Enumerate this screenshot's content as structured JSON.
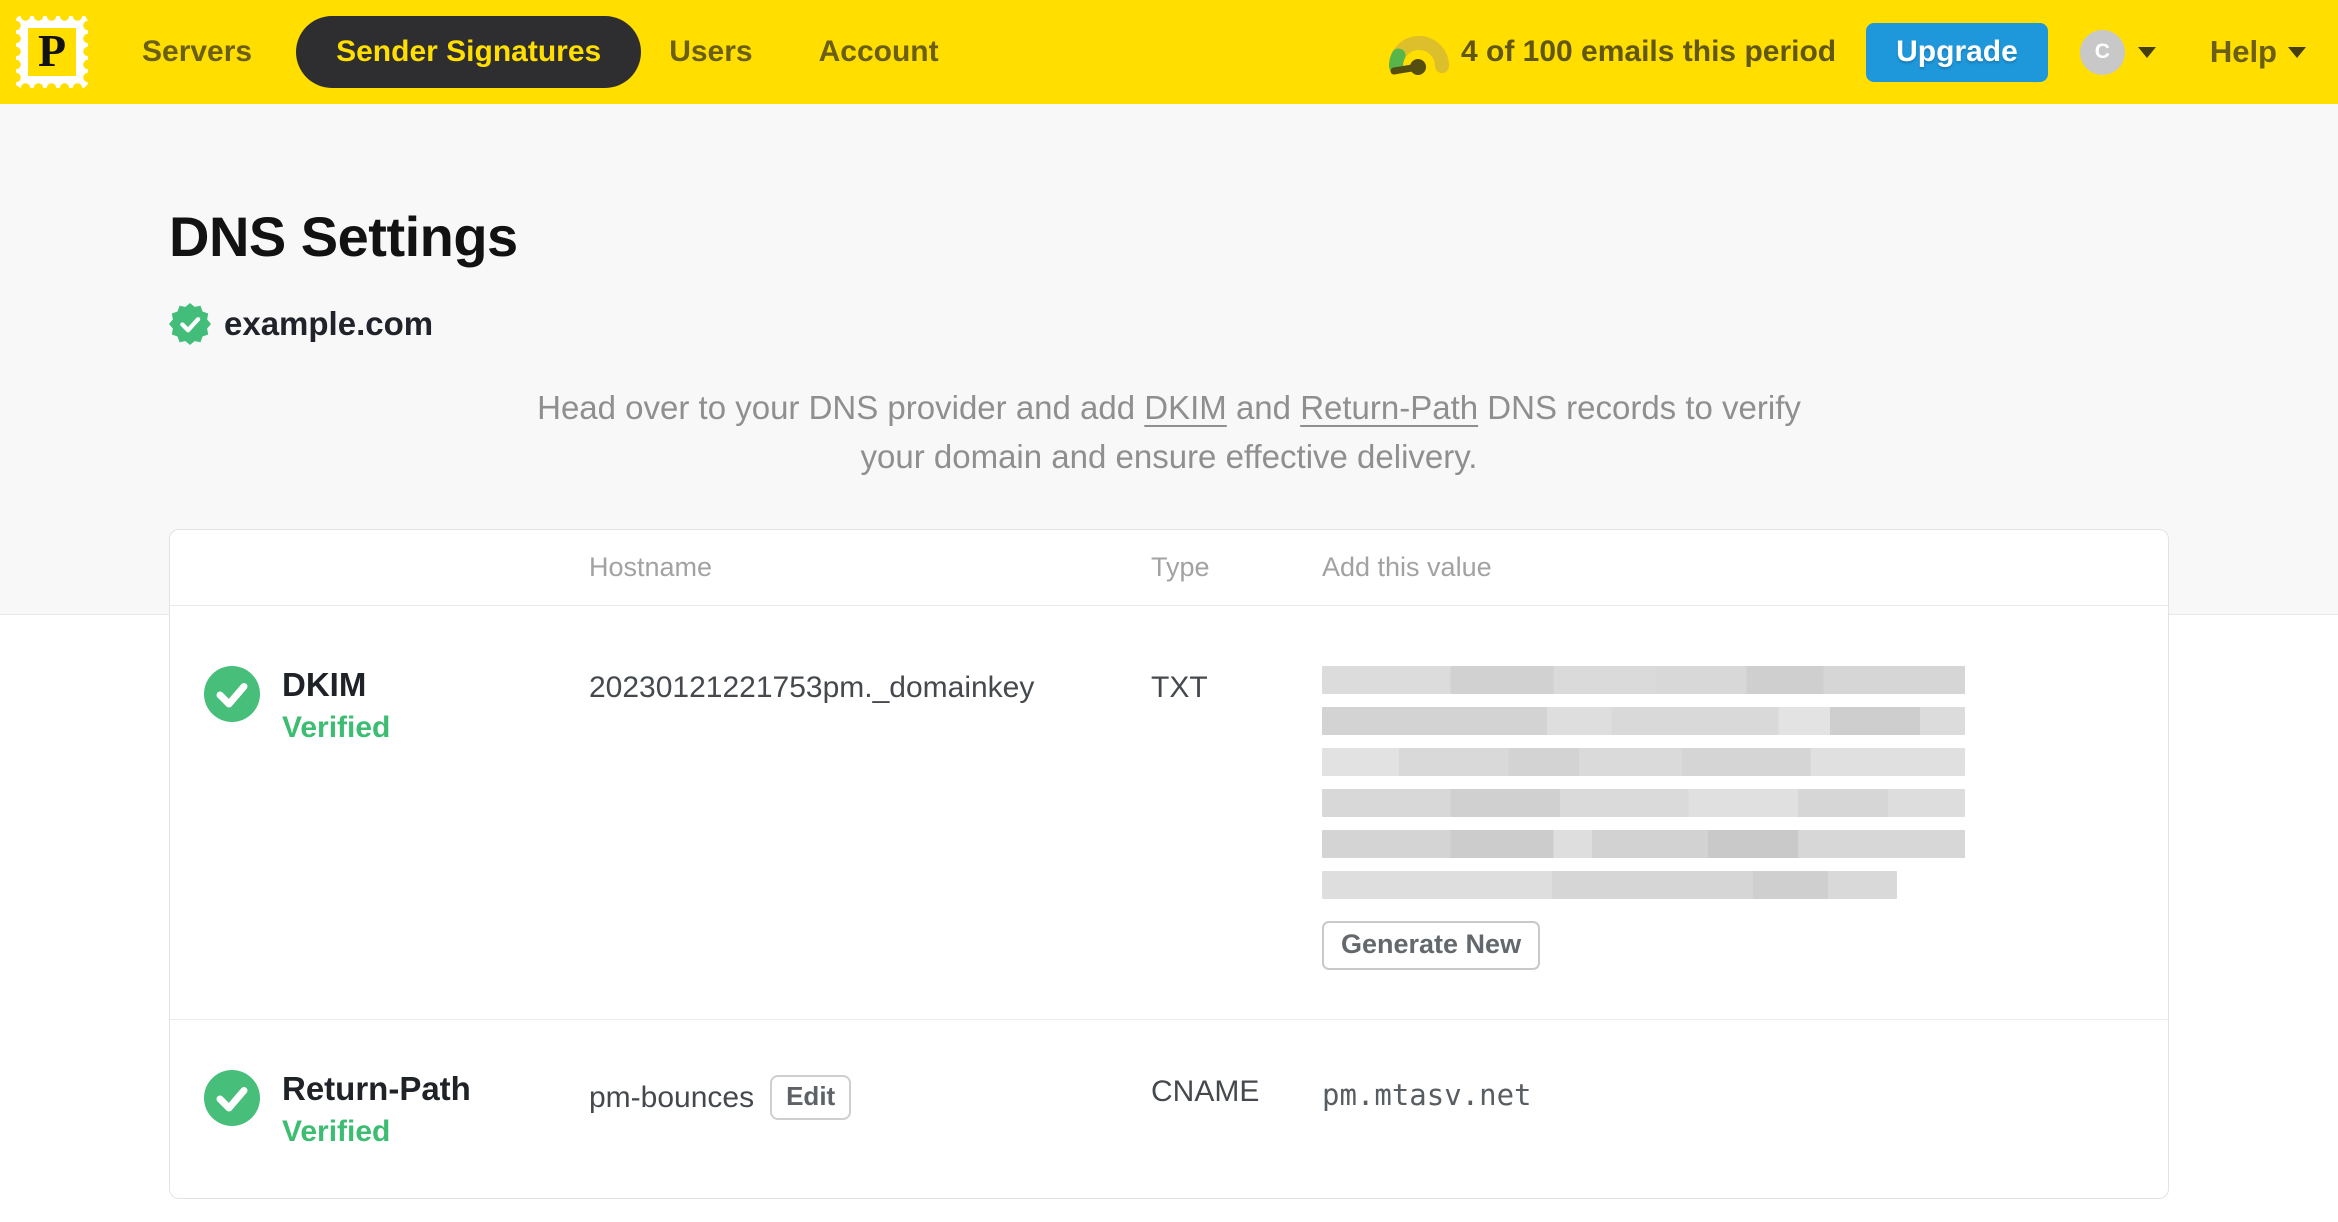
{
  "navbar": {
    "logo_letter": "P",
    "items": [
      {
        "label": "Servers",
        "active": false
      },
      {
        "label": "Sender Signatures",
        "active": true
      },
      {
        "label": "Users",
        "active": false
      },
      {
        "label": "Account",
        "active": false
      }
    ],
    "usage_text": "4 of 100 emails this period",
    "upgrade_label": "Upgrade",
    "avatar_initial": "C",
    "help_label": "Help"
  },
  "page": {
    "title": "DNS Settings",
    "domain": "example.com",
    "description": {
      "part1": "Head over to your DNS provider and add ",
      "link_dkim": "DKIM",
      "part2": " and ",
      "link_return_path": "Return-Path",
      "part3": " DNS records to verify your domain and ensure effective delivery."
    }
  },
  "table": {
    "headers": {
      "hostname": "Hostname",
      "type": "Type",
      "value": "Add this value"
    },
    "rows": [
      {
        "name": "DKIM",
        "status": "Verified",
        "hostname": "20230121221753pm._domainkey",
        "type": "TXT",
        "value_redacted": true,
        "action_label": "Generate New"
      },
      {
        "name": "Return-Path",
        "status": "Verified",
        "hostname": "pm-bounces",
        "edit_label": "Edit",
        "type": "CNAME",
        "value": "pm.mtasv.net"
      }
    ]
  },
  "colors": {
    "brand_yellow": "#FFDE00",
    "accent_blue": "#1E97DB",
    "success_green": "#3DBD72",
    "nav_active_bg": "#2E2E30"
  }
}
